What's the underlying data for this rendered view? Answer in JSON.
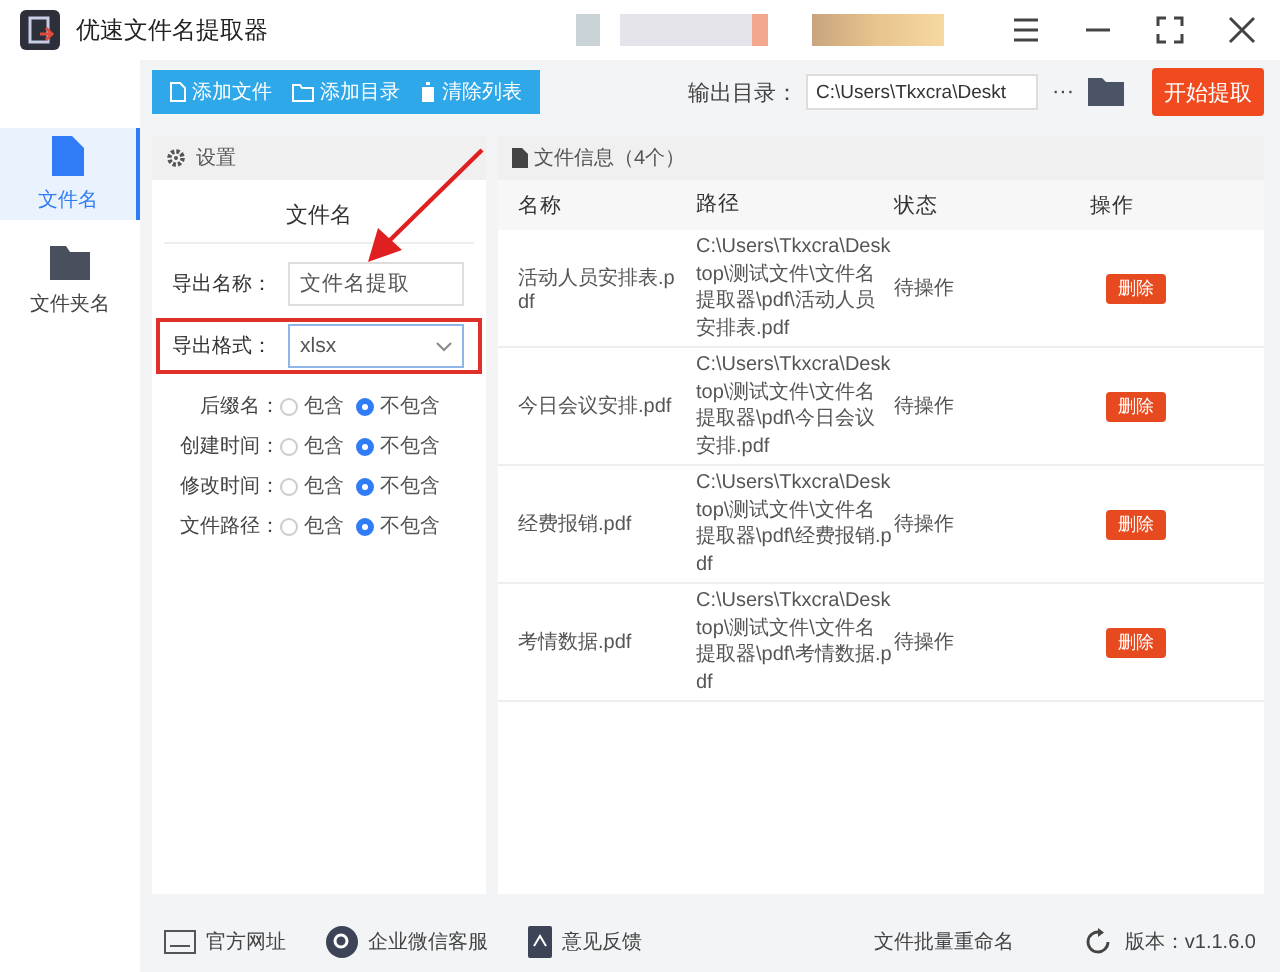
{
  "window": {
    "title": "优速文件名提取器"
  },
  "toolbar": {
    "buttons": [
      {
        "kind": "file",
        "label": "添加文件"
      },
      {
        "kind": "folder",
        "label": "添加目录"
      },
      {
        "kind": "trash",
        "label": "清除列表"
      }
    ],
    "output_label": "输出目录：",
    "output_value": "C:\\Users\\Tkxcra\\Deskt",
    "more": "···",
    "start": "开始提取"
  },
  "sidebar": {
    "items": [
      {
        "kind": "file",
        "label": "文件名",
        "selected": true
      },
      {
        "kind": "folder",
        "label": "文件夹名",
        "selected": false
      }
    ]
  },
  "settings": {
    "title": "设置",
    "section": "文件名",
    "name_label": "导出名称：",
    "name_value": "文件名提取",
    "format_label": "导出格式：",
    "format_value": "xlsx",
    "options": [
      {
        "label": "后缀名：",
        "choices": [
          {
            "label": "包含",
            "selected": false
          },
          {
            "label": "不包含",
            "selected": true
          }
        ]
      },
      {
        "label": "创建时间：",
        "choices": [
          {
            "label": "包含",
            "selected": false
          },
          {
            "label": "不包含",
            "selected": true
          }
        ]
      },
      {
        "label": "修改时间：",
        "choices": [
          {
            "label": "包含",
            "selected": false
          },
          {
            "label": "不包含",
            "selected": true
          }
        ]
      },
      {
        "label": "文件路径：",
        "choices": [
          {
            "label": "包含",
            "selected": false
          },
          {
            "label": "不包含",
            "selected": true
          }
        ]
      }
    ]
  },
  "files": {
    "title": "文件信息（4个）",
    "columns": [
      "名称",
      "路径",
      "状态",
      "操作"
    ],
    "rows": [
      {
        "name": "活动人员安排表.pdf",
        "path": "C:\\Users\\Tkxcra\\Desktop\\测试文件\\文件名提取器\\pdf\\活动人员安排表.pdf",
        "status": "待操作",
        "action": "删除"
      },
      {
        "name": "今日会议安排.pdf",
        "path": "C:\\Users\\Tkxcra\\Desktop\\测试文件\\文件名提取器\\pdf\\今日会议安排.pdf",
        "status": "待操作",
        "action": "删除"
      },
      {
        "name": "经费报销.pdf",
        "path": "C:\\Users\\Tkxcra\\Desktop\\测试文件\\文件名提取器\\pdf\\经费报销.pdf",
        "status": "待操作",
        "action": "删除"
      },
      {
        "name": "考情数据.pdf",
        "path": "C:\\Users\\Tkxcra\\Desktop\\测试文件\\文件名提取器\\pdf\\考情数据.pdf",
        "status": "待操作",
        "action": "删除"
      }
    ]
  },
  "footer": {
    "links": [
      {
        "kind": "web",
        "label": "官方网址"
      },
      {
        "kind": "chat",
        "label": "企业微信客服"
      },
      {
        "kind": "feedback",
        "label": "意见反馈"
      }
    ],
    "center": "文件批量重命名",
    "version": "版本：v1.1.6.0"
  }
}
